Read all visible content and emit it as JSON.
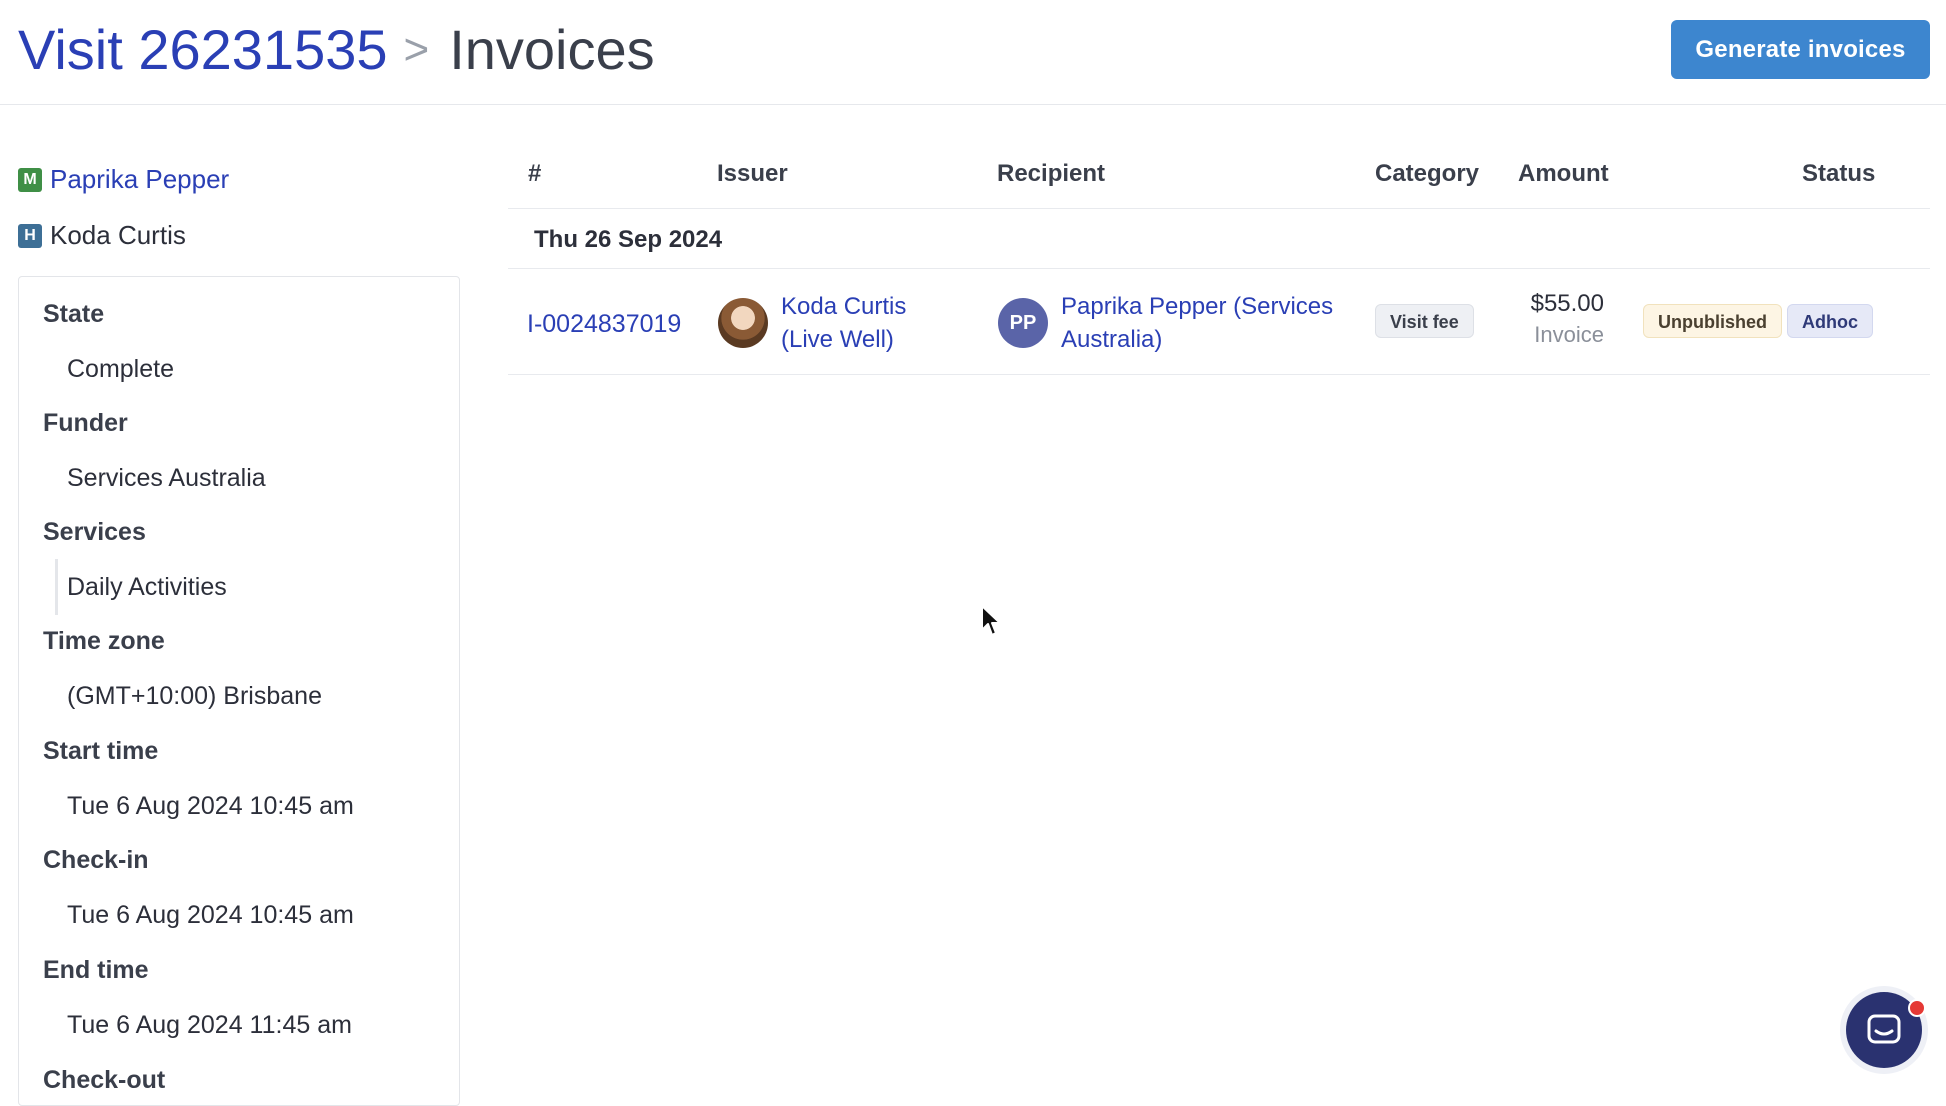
{
  "header": {
    "breadcrumb_link": "Visit 26231535",
    "breadcrumb_separator": ">",
    "breadcrumb_current": "Invoices",
    "generate_button": "Generate invoices"
  },
  "people": [
    {
      "tag": "M",
      "name": "Paprika Pepper"
    },
    {
      "tag": "H",
      "name": "Koda Curtis"
    }
  ],
  "details": {
    "state_label": "State",
    "state_value": "Complete",
    "funder_label": "Funder",
    "funder_value": "Services Australia",
    "services_label": "Services",
    "services_value": "Daily Activities",
    "timezone_label": "Time zone",
    "timezone_value": "(GMT+10:00) Brisbane",
    "start_label": "Start time",
    "start_value": "Tue 6 Aug 2024 10:45 am",
    "checkin_label": "Check-in",
    "checkin_value": "Tue 6 Aug 2024 10:45 am",
    "end_label": "End time",
    "end_value": "Tue 6 Aug 2024 11:45 am",
    "checkout_label": "Check-out"
  },
  "table": {
    "columns": [
      "#",
      "Issuer",
      "Recipient",
      "Category",
      "Amount",
      "Status"
    ],
    "group_date": "Thu 26 Sep 2024",
    "rows": [
      {
        "id": "I-0024837019",
        "issuer_line1": "Koda Curtis",
        "issuer_line2": "(Live Well)",
        "recipient_initials": "PP",
        "recipient_line1": "Paprika Pepper (Services",
        "recipient_line2": "Australia)",
        "category": "Visit fee",
        "amount": "$55.00",
        "amount_type": "Invoice",
        "status": "Unpublished",
        "status_tag": "Adhoc"
      }
    ]
  },
  "icons": {
    "chat": "chat-bubble-icon",
    "cursor": "mouse-pointer-icon"
  },
  "colors": {
    "primary_button": "#3d86cf",
    "link": "#2a3fb5",
    "chat_button": "#2a3270",
    "notification_dot": "#e53935"
  }
}
